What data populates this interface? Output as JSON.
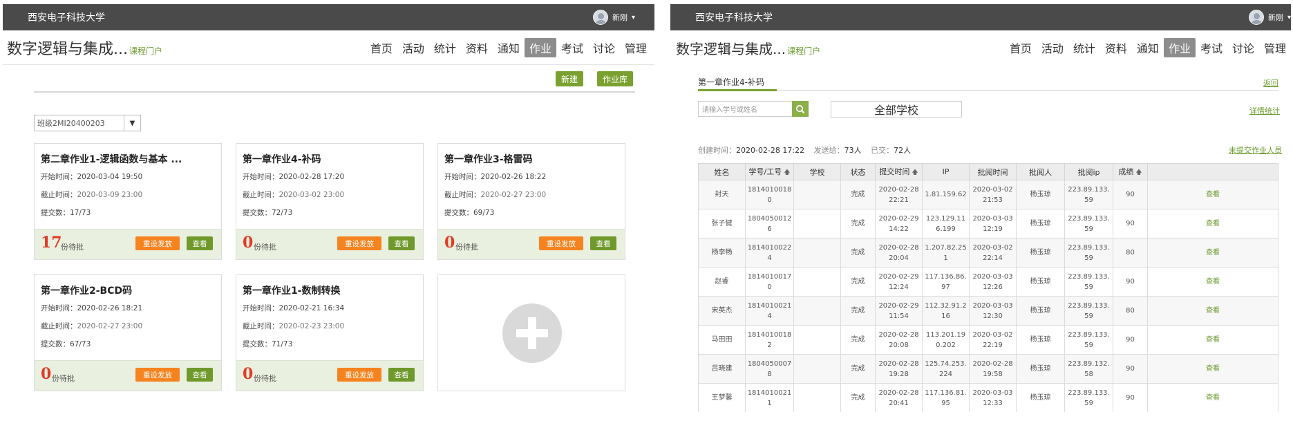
{
  "common": {
    "school": "西安电子科技大学",
    "user": "新刚",
    "course_title": "数字逻辑与集成...",
    "portal": "课程门户",
    "nav": [
      "首页",
      "活动",
      "统计",
      "资料",
      "通知",
      "作业",
      "考试",
      "讨论",
      "管理"
    ],
    "active_nav": "作业"
  },
  "left": {
    "new_btn": "新建",
    "library_btn": "作业库",
    "class_select": "班级2MI20400203",
    "labels": {
      "start": "开始时间：",
      "end": "截止时间：",
      "submitted": "提交数：",
      "pending": "份待批",
      "reset": "重设发放",
      "view": "查看"
    },
    "cards": [
      {
        "title": "第二章作业1-逻辑函数与基本 ...",
        "start": "2020-03-04 19:50",
        "end": "2020-03-09 23:00",
        "submitted": "17/73",
        "pending": "17"
      },
      {
        "title": "第一章作业4-补码",
        "start": "2020-02-28 17:20",
        "end": "2020-03-02 23:00",
        "submitted": "72/73",
        "pending": "0"
      },
      {
        "title": "第一章作业3-格雷码",
        "start": "2020-02-26 18:22",
        "end": "2020-02-27 23:00",
        "submitted": "69/73",
        "pending": "0"
      },
      {
        "title": "第一章作业2-BCD码",
        "start": "2020-02-26 18:21",
        "end": "2020-02-27 23:00",
        "submitted": "67/73",
        "pending": "0"
      },
      {
        "title": "第一章作业1-数制转换",
        "start": "2020-02-21 16:34",
        "end": "2020-02-23 23:00",
        "submitted": "71/73",
        "pending": "0"
      }
    ]
  },
  "right": {
    "tab_title": "第一章作业4-补码",
    "back": "返回",
    "search_placeholder": "请输入学号或姓名",
    "school_filter": "全部学校",
    "detail_stats": "详情统计",
    "meta": {
      "created_label": "创建时间：",
      "created": "2020-02-28 17:22",
      "sent_label": "发送给：",
      "sent": "73人",
      "submitted_label": "已交：",
      "submitted": "72人"
    },
    "unsubmitted_link": "未提交作业人员",
    "columns": [
      "姓名",
      "学号/工号",
      "学校",
      "状态",
      "提交时间",
      "IP",
      "批阅时间",
      "批阅人",
      "批阅ip",
      "成绩",
      ""
    ],
    "rows": [
      [
        "封天",
        "18140100180",
        "",
        "完成",
        "2020-02-28 22:21",
        "1.81.159.62",
        "2020-03-02 21:53",
        "杨玉琼",
        "223.89.133.59",
        "90",
        "查看"
      ],
      [
        "张子健",
        "18040500126",
        "",
        "完成",
        "2020-02-29 14:22",
        "123.129.116.199",
        "2020-03-03 12:19",
        "杨玉琼",
        "223.89.133.59",
        "90",
        "查看"
      ],
      [
        "杨李畅",
        "18140100224",
        "",
        "完成",
        "2020-02-28 20:04",
        "1.207.82.251",
        "2020-03-02 22:14",
        "杨玉琼",
        "223.89.133.59",
        "80",
        "查看"
      ],
      [
        "赵睿",
        "18140100170",
        "",
        "完成",
        "2020-02-29 12:24",
        "117.136.86.97",
        "2020-03-03 12:26",
        "杨玉琼",
        "223.89.133.59",
        "90",
        "查看"
      ],
      [
        "宋英杰",
        "18140100214",
        "",
        "完成",
        "2020-02-29 11:54",
        "112.32.91.216",
        "2020-03-03 12:30",
        "杨玉琼",
        "223.89.133.59",
        "80",
        "查看"
      ],
      [
        "马田田",
        "18140100182",
        "",
        "完成",
        "2020-02-28 20:08",
        "113.201.190.202",
        "2020-03-02 22:19",
        "杨玉琼",
        "223.89.133.59",
        "90",
        "查看"
      ],
      [
        "吕晓建",
        "18040500078",
        "",
        "完成",
        "2020-02-28 19:28",
        "125.74.253.224",
        "2020-02-28 19:58",
        "杨玉琼",
        "223.89.132.58",
        "90",
        "查看"
      ],
      [
        "王梦馨",
        "18140100211",
        "",
        "完成",
        "2020-02-28 20:41",
        "117.136.81.95",
        "2020-03-03 12:33",
        "杨玉琼",
        "223.89.133.59",
        "90",
        "查看"
      ]
    ]
  },
  "colors": {
    "green": "#7aa12f",
    "orange": "#f5831f",
    "red": "#e23b26",
    "topbar": "#4a4a4a"
  }
}
